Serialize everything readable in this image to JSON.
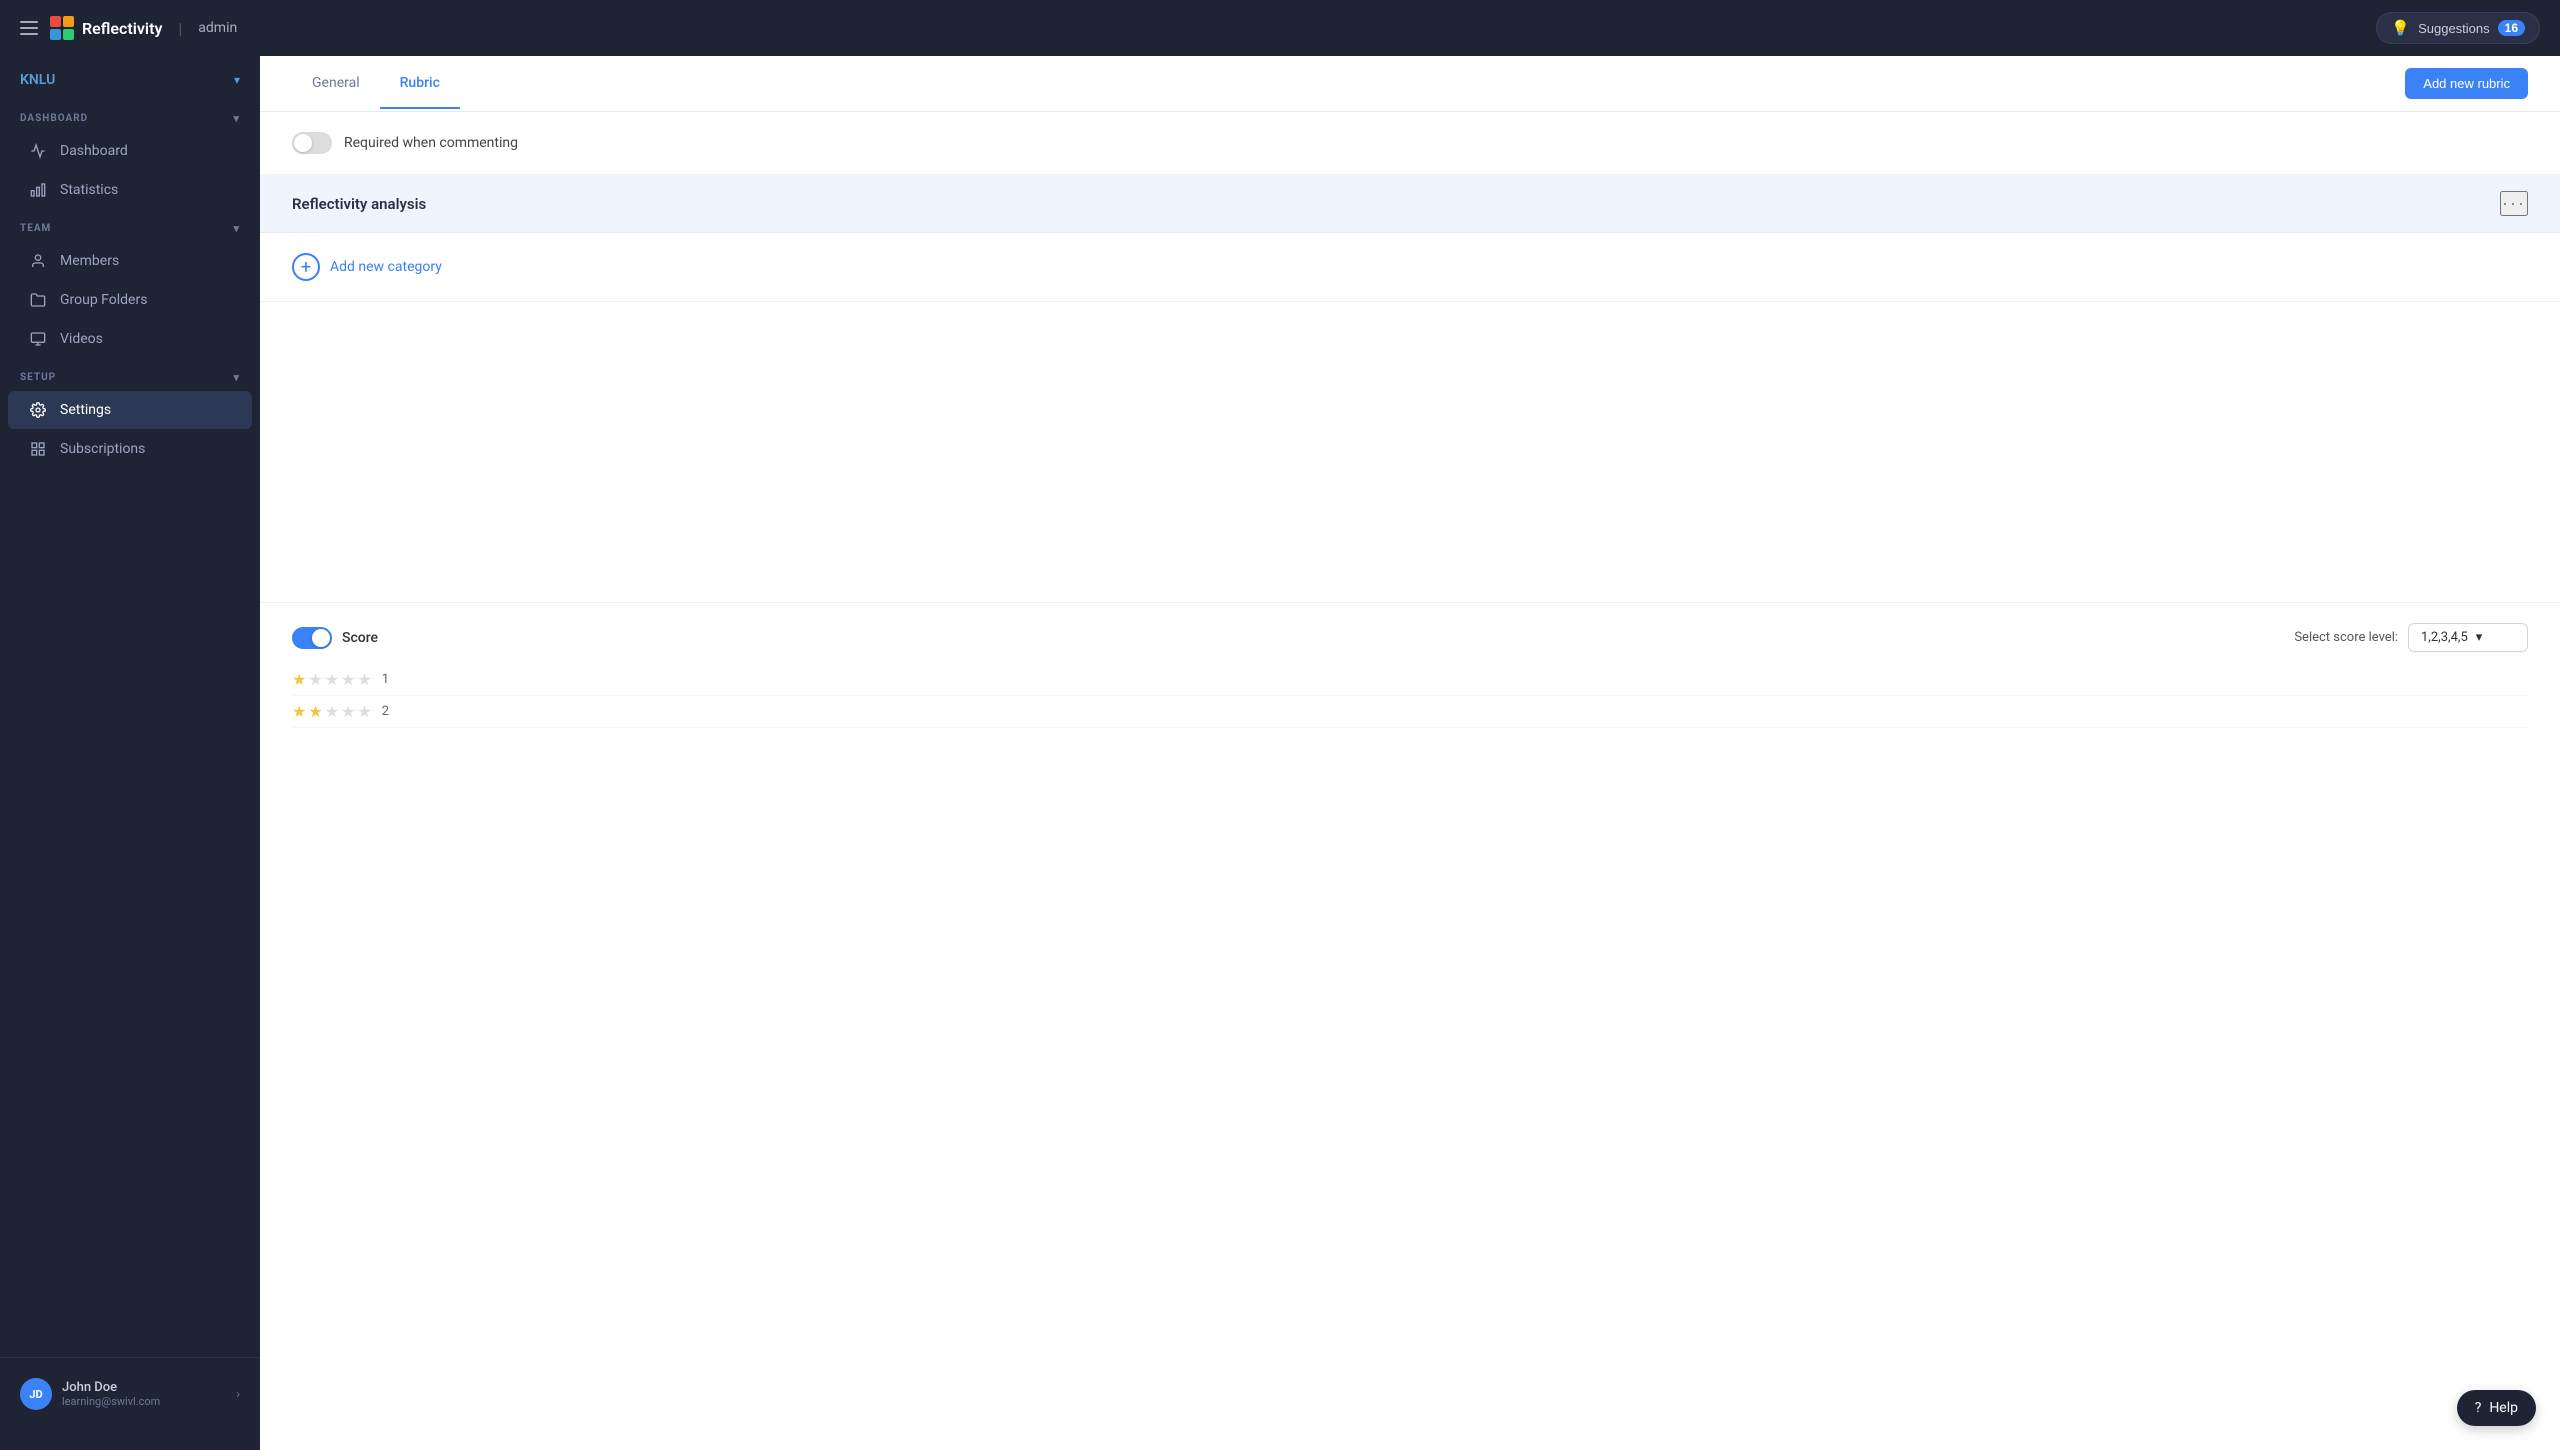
{
  "app": {
    "name": "Reflectivity",
    "admin_label": "admin",
    "logo_alt": "Reflectivity logo"
  },
  "topnav": {
    "suggestions_label": "Suggestions",
    "suggestions_count": "16"
  },
  "sidebar": {
    "org": {
      "name": "KNLU",
      "chevron": "▾"
    },
    "sections": [
      {
        "id": "dashboard",
        "label": "DASHBOARD",
        "items": [
          {
            "id": "dashboard",
            "label": "Dashboard",
            "icon": "📈",
            "active": false
          },
          {
            "id": "statistics",
            "label": "Statistics",
            "icon": "📊",
            "active": false
          }
        ]
      },
      {
        "id": "team",
        "label": "TEAM",
        "items": [
          {
            "id": "members",
            "label": "Members",
            "icon": "👤",
            "active": false
          },
          {
            "id": "group-folders",
            "label": "Group Folders",
            "icon": "📁",
            "active": false
          },
          {
            "id": "videos",
            "label": "Videos",
            "icon": "▦",
            "active": false
          }
        ]
      },
      {
        "id": "setup",
        "label": "SETUP",
        "items": [
          {
            "id": "settings",
            "label": "Settings",
            "icon": "⚙️",
            "active": true
          },
          {
            "id": "subscriptions",
            "label": "Subscriptions",
            "icon": "▦",
            "active": false
          }
        ]
      }
    ],
    "user": {
      "initials": "JD",
      "name": "John Doe",
      "email": "learning@swivl.com"
    }
  },
  "main": {
    "tabs": [
      {
        "id": "general",
        "label": "General",
        "active": false
      },
      {
        "id": "rubric",
        "label": "Rubric",
        "active": true
      }
    ],
    "action_button": "Add new rubric",
    "toggle_label": "Required when commenting",
    "category_title": "Reflectivity analysis",
    "more_icon": "•••",
    "add_category_label": "Add new category",
    "score": {
      "label": "Score",
      "enabled": true,
      "score_level_label": "Select score level:",
      "score_level_value": "1,2,3,4,5",
      "stars": [
        {
          "filled": 1,
          "empty": 4,
          "count": "1"
        },
        {
          "filled": 2,
          "empty": 3,
          "count": "2"
        }
      ]
    }
  },
  "help": {
    "label": "Help"
  }
}
